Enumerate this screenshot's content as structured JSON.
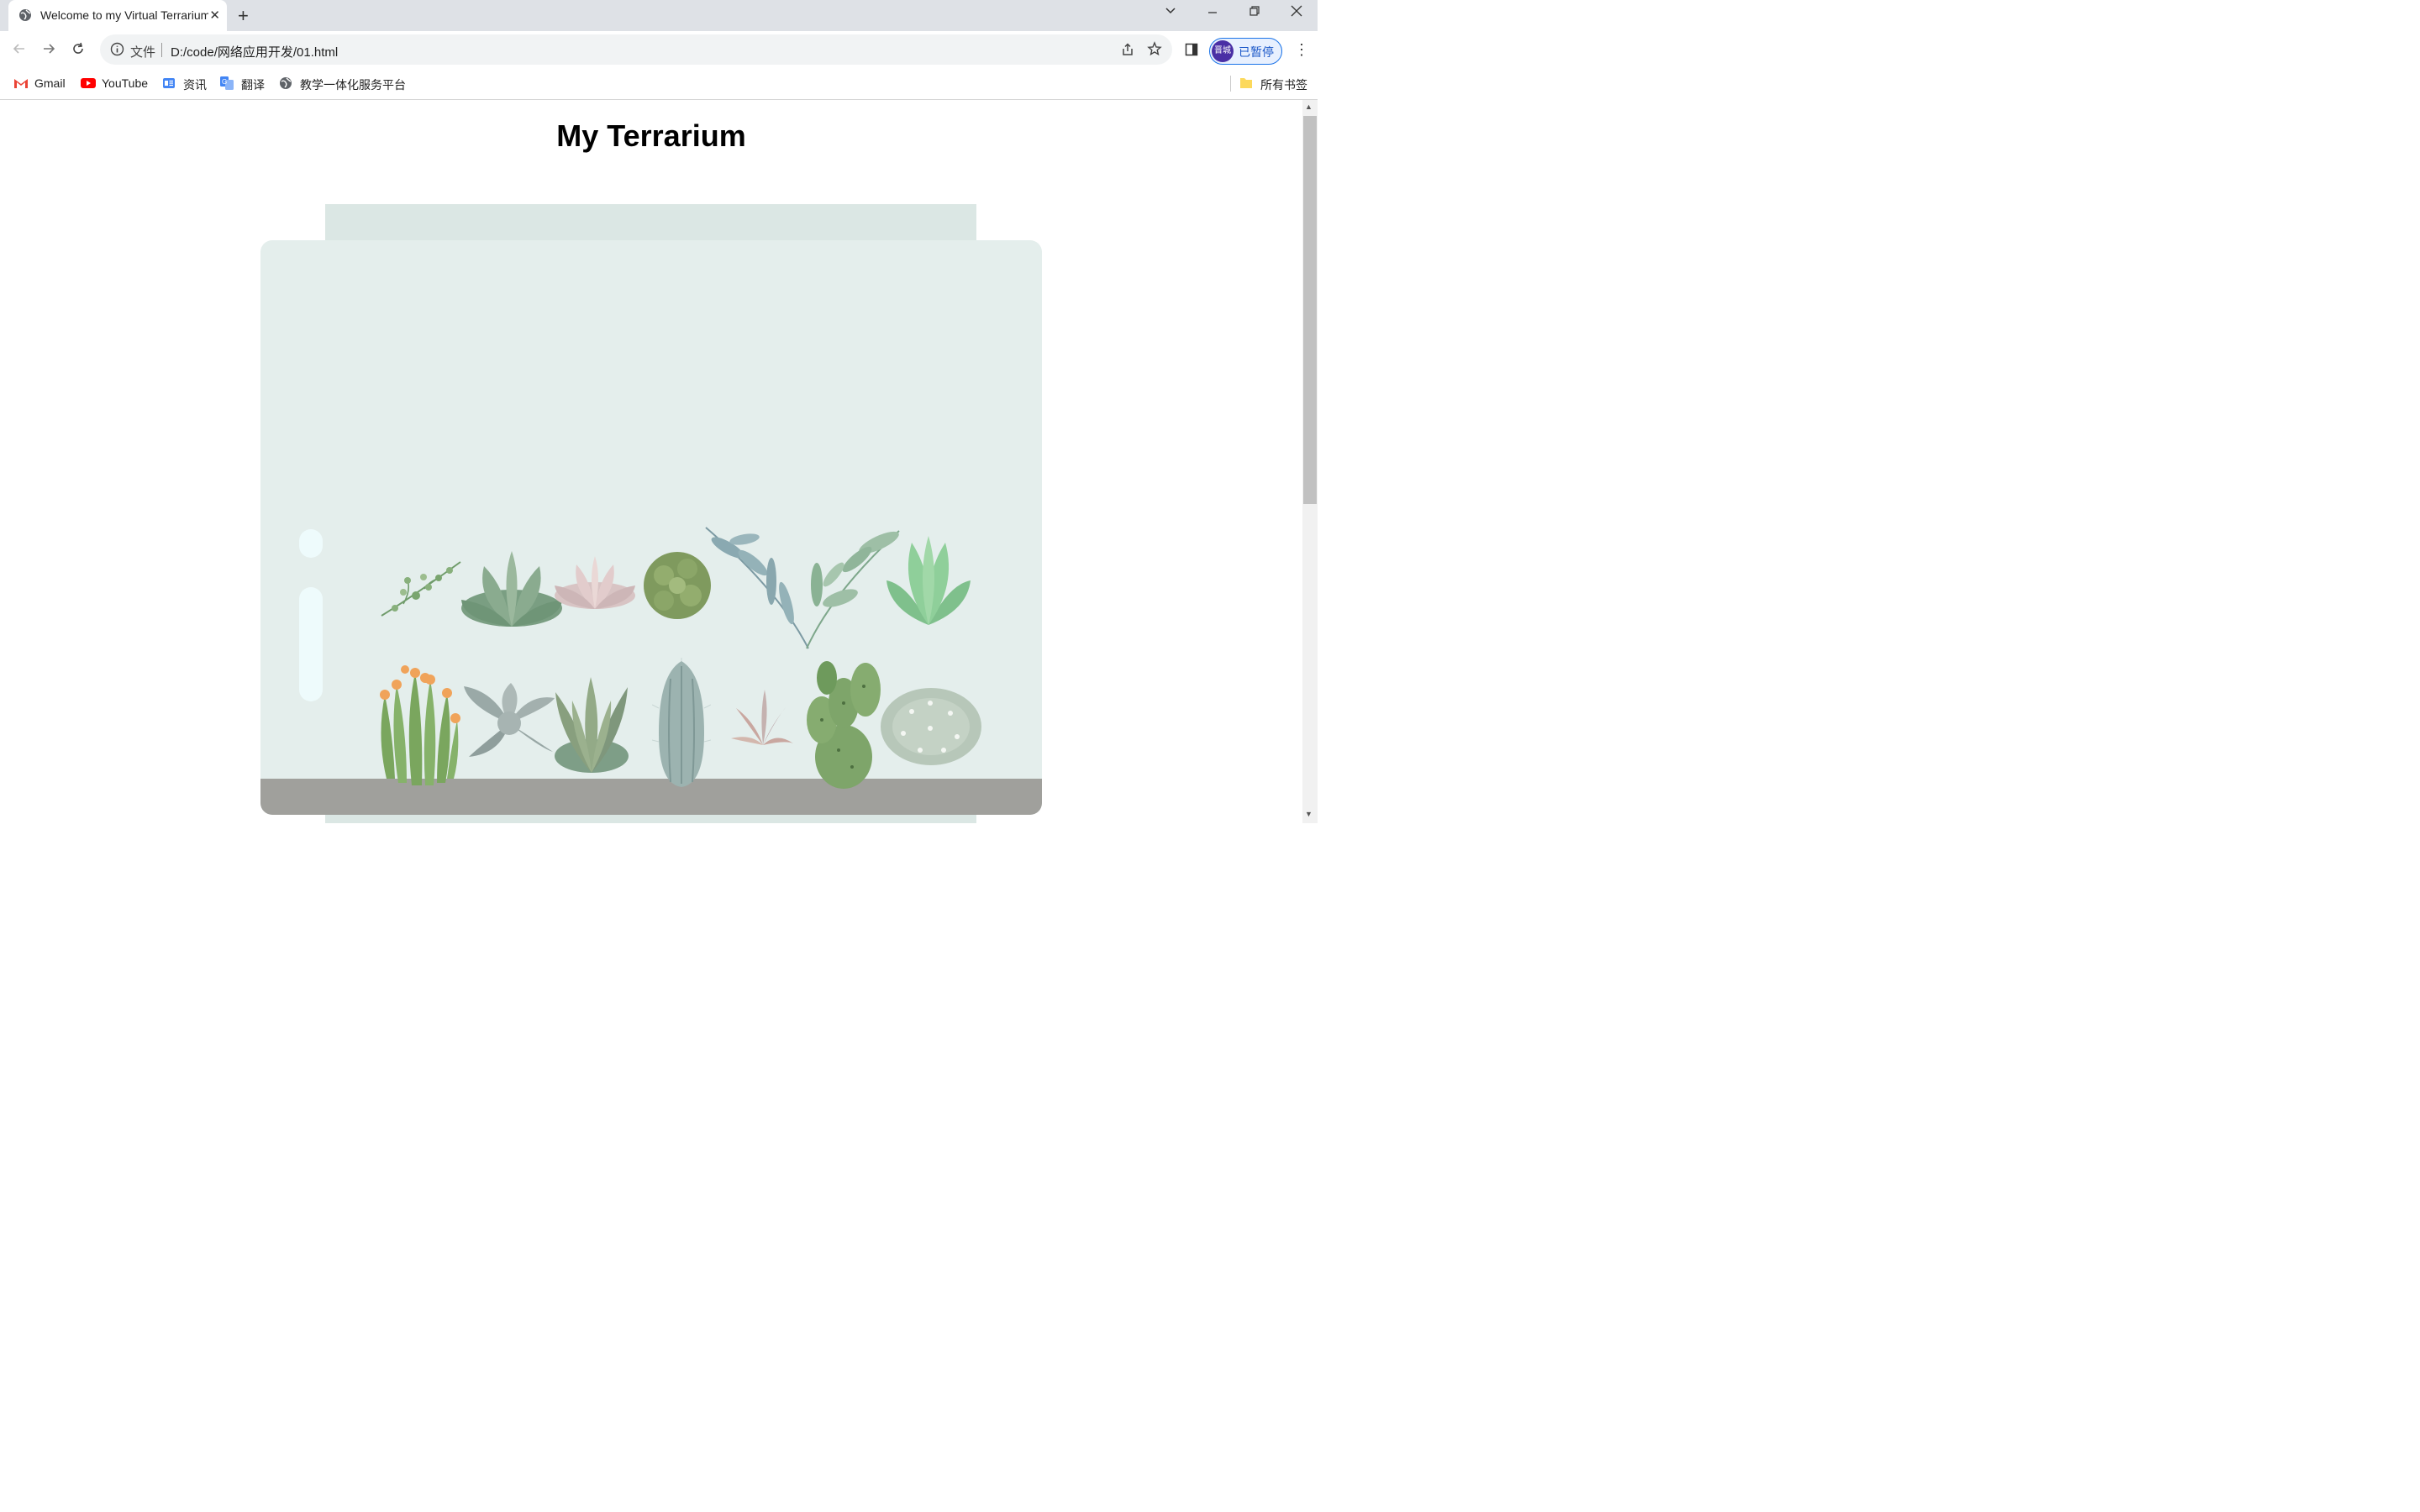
{
  "browser": {
    "tab_title": "Welcome to my Virtual Terrarium",
    "address_scheme": "文件",
    "url": "D:/code/网络应用开发/01.html",
    "profile_avatar": "晋城",
    "profile_status": "已暂停"
  },
  "bookmarks": {
    "items": [
      "Gmail",
      "YouTube",
      "资讯",
      "翻译",
      "教学一体化服务平台"
    ],
    "all_bookmarks": "所有书签"
  },
  "page": {
    "title": "My Terrarium"
  },
  "colors": {
    "jar_glass": "#e4eeec",
    "jar_top": "#dbe7e4",
    "jar_bottom": "#a0a09c",
    "glossy": "#eefbfc"
  },
  "icons": [
    "globe-icon",
    "close-icon",
    "plus-icon",
    "chevron-down-icon",
    "minimize-icon",
    "restore-icon",
    "back-arrow-icon",
    "forward-arrow-icon",
    "reload-icon",
    "info-icon",
    "share-icon",
    "star-icon",
    "side-panel-icon",
    "kebab-menu-icon",
    "gmail-icon",
    "youtube-icon",
    "folder-icon"
  ]
}
